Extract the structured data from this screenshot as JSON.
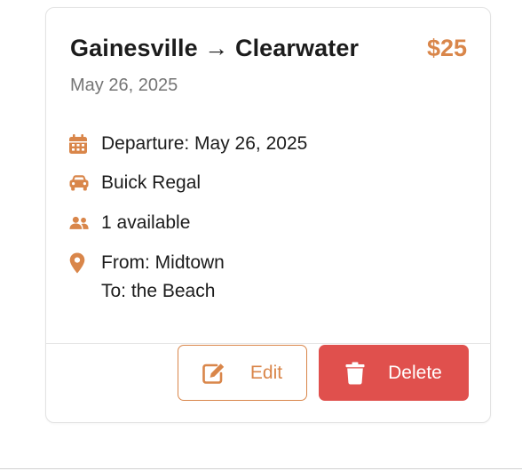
{
  "trip": {
    "title": "Gainesville → Clearwater",
    "price": "$25",
    "date": "May 26, 2025",
    "departure": "Departure: May 26, 2025",
    "vehicle": "Buick Regal",
    "seats": "1 available",
    "from": "From: Midtown",
    "to": "To: the Beach"
  },
  "actions": {
    "edit_label": "Edit",
    "delete_label": "Delete"
  },
  "icons": {
    "departure": "calendar-icon",
    "vehicle": "car-icon",
    "seats": "users-icon",
    "route": "map-pin-icon",
    "edit": "edit-icon",
    "delete": "trash-icon"
  },
  "colors": {
    "accent": "#d9864a",
    "danger": "#e0504d",
    "muted_text": "#757575"
  }
}
